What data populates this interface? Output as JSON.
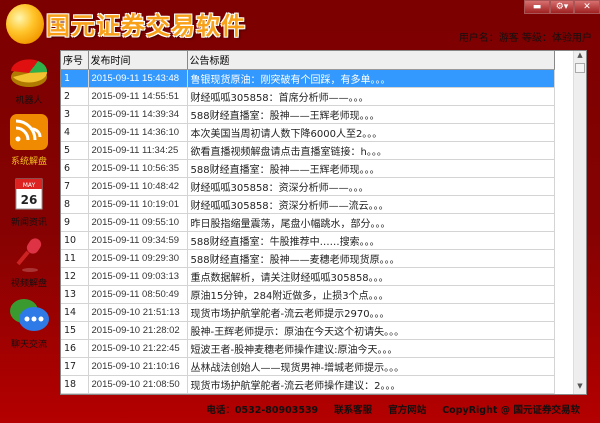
{
  "app": {
    "title": "国元证券交易软件",
    "user_info": "用户名：游客 等级：体验用户"
  },
  "window_controls": {
    "minimize": "▬",
    "menu": "⚙▾",
    "close": "✕"
  },
  "sidebar": [
    {
      "label": "机器人",
      "icon": "pie-chart-icon"
    },
    {
      "label": "系统解盘",
      "icon": "rss-icon"
    },
    {
      "label": "新闻资讯",
      "icon": "calendar-icon",
      "day": "26",
      "month": "MAY"
    },
    {
      "label": "视频解盘",
      "icon": "microphone-icon"
    },
    {
      "label": "聊天交流",
      "icon": "chat-icon"
    }
  ],
  "table": {
    "headers": [
      "序号",
      "发布时间",
      "公告标题"
    ],
    "rows": [
      [
        "1",
        "2015-09-11 15:43:48",
        "鲁银现货原油：刚突破有个回踩，有多单。。。"
      ],
      [
        "2",
        "2015-09-11 14:55:51",
        "财经呱呱305858：首席分析师——。。。"
      ],
      [
        "3",
        "2015-09-11 14:39:34",
        "588财经直播室：股神——王辉老师现。。。"
      ],
      [
        "4",
        "2015-09-11 14:36:10",
        " 本次美国当周初请人数下降6000人至2。。。"
      ],
      [
        "5",
        "2015-09-11 11:34:25",
        "欲看直播视频解盘请点击直播室链接：h。。。"
      ],
      [
        "6",
        "2015-09-11 10:56:35",
        "588财经直播室：股神——王辉老师现。。。"
      ],
      [
        "7",
        "2015-09-11 10:48:42",
        "财经呱呱305858：资深分析师——。。。"
      ],
      [
        "8",
        "2015-09-11 10:19:01",
        "财经呱呱305858：资深分析师——流云。。。"
      ],
      [
        "9",
        "2015-09-11 09:55:10",
        "昨日股指缩量震荡，尾盘小幅跳水，部分。。。"
      ],
      [
        "10",
        "2015-09-11 09:34:59",
        "588财经直播室：牛股推荐中……搜索。。。"
      ],
      [
        "11",
        "2015-09-11 09:29:30",
        "588财经直播室：股神——麦穗老师现货原。。。"
      ],
      [
        "12",
        "2015-09-11 09:03:13",
        "重点数据解析，请关注财经呱呱305858。。。"
      ],
      [
        "13",
        "2015-09-11 08:50:49",
        "原油15分钟，284附近做多，止损3个点。。。"
      ],
      [
        "14",
        "2015-09-10 21:51:13",
        "现货市场护航掌舵者-流云老师提示2970。。。"
      ],
      [
        "15",
        "2015-09-10 21:28:02",
        "股神-王辉老师提示：原油在今天这个初请失。。。"
      ],
      [
        "16",
        "2015-09-10 21:22:45",
        "短波王者-股神麦穗老师操作建议:原油今天。。。"
      ],
      [
        "17",
        "2015-09-10 21:10:16",
        "丛林战法创始人——现货男神-增城老师提示。。。"
      ],
      [
        "18",
        "2015-09-10 21:08:50",
        "现货市场护航掌舵者-流云老师操作建议：2。。。"
      ]
    ]
  },
  "footer": {
    "phone": "电话：0532-80903539",
    "service": "联系客服",
    "website": "官方网站",
    "copyright": "CopyRight @ 国元证券交易软"
  },
  "colors": {
    "selected": "#3399ff",
    "background": "#7c0000"
  }
}
